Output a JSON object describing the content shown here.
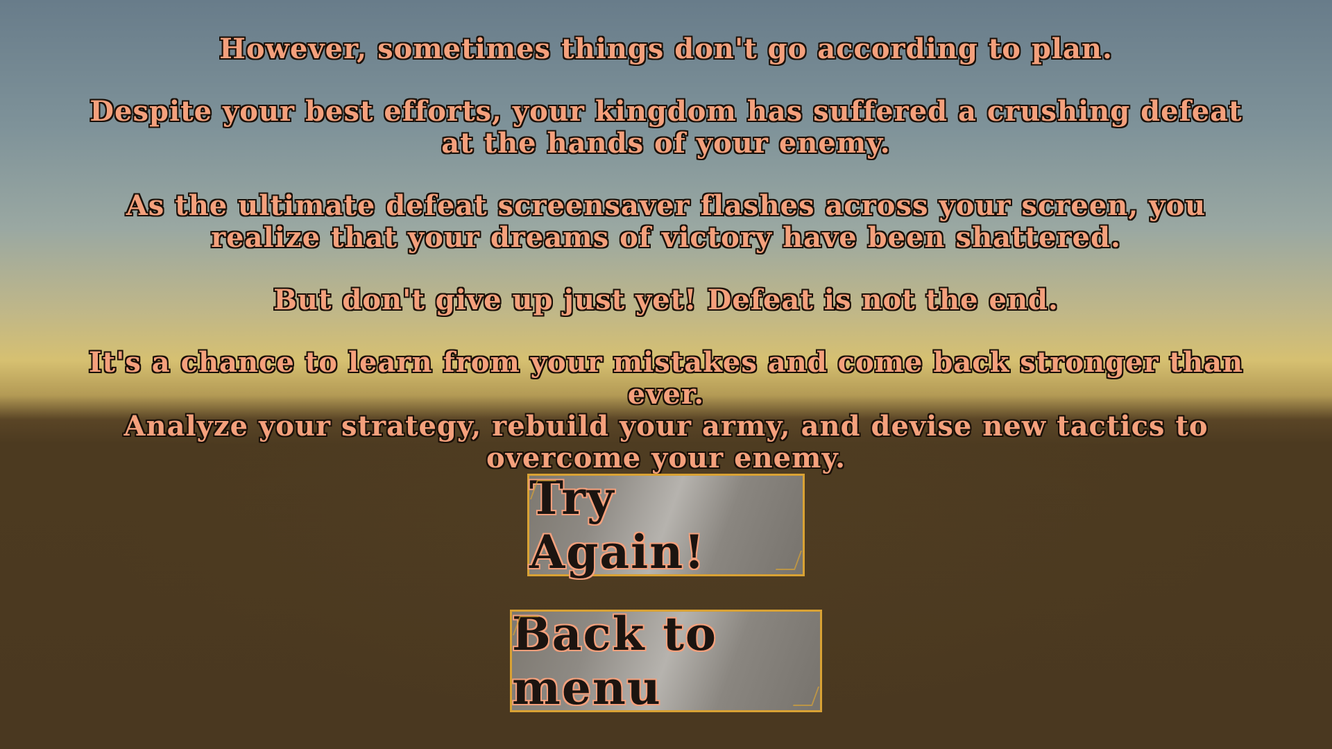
{
  "story": {
    "line1": "However, sometimes things don't go according to plan.",
    "line2": "Despite your best efforts, your kingdom has suffered a crushing defeat at the hands of your enemy.",
    "line3": "As the ultimate defeat screensaver flashes across your screen, you realize that your dreams of victory have been shattered.",
    "line4": "But don't give up just yet! Defeat is not the end.",
    "line5": "It's a chance to learn from your mistakes and come back stronger than ever.",
    "line6": "Analyze your strategy, rebuild your army, and devise new tactics to overcome your enemy."
  },
  "buttons": {
    "try_again": "Try Again!",
    "back_to_menu": "Back to menu"
  },
  "colors": {
    "text": "#f4a07c",
    "outline": "#1a1008",
    "button_border": "#d9a234",
    "ground": "#4a3820"
  }
}
